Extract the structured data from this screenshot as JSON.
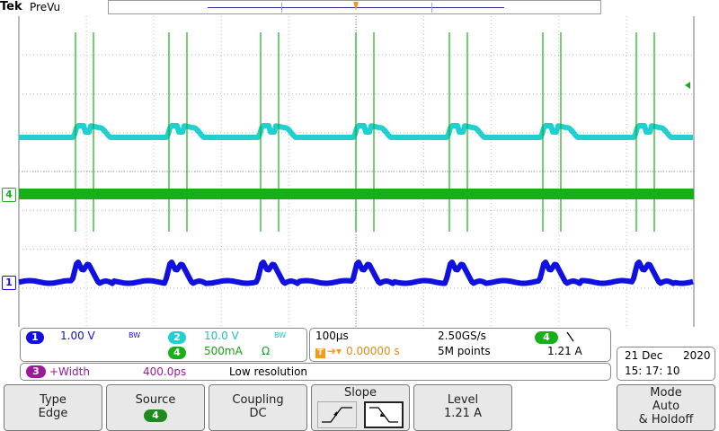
{
  "header": {
    "brand": "Tek",
    "mode": "PreVu"
  },
  "markers": {
    "trigger": "T",
    "ch4_ref": "4",
    "ch1_ref": "1"
  },
  "channels": {
    "ch1": {
      "num": "1",
      "scale": "1.00 V",
      "bw": "BW",
      "color": "#1010e0"
    },
    "ch2": {
      "num": "2",
      "scale": "10.0 V",
      "bw": "BW",
      "color": "#20d0d0"
    },
    "ch4": {
      "num": "4",
      "scale": "500mA",
      "coupling": "Ω",
      "color": "#18b018"
    }
  },
  "acquisition": {
    "timebase": "100µs",
    "sample_rate": "2.50GS/s",
    "trigger_position": "0.00000 s",
    "record_length": "5M points",
    "trigger_source": "4",
    "trigger_slope_icon": "falling-slope",
    "trigger_level": "1.21 A"
  },
  "measurement": {
    "num": "3",
    "label": "+Width",
    "value": "400.0ps",
    "status": "Low resolution"
  },
  "datetime": {
    "date": "21 Dec",
    "year": "2020",
    "time": "15: 17: 10"
  },
  "menu": {
    "type": {
      "label": "Type",
      "value": "Edge"
    },
    "source": {
      "label": "Source",
      "value": "4"
    },
    "coupling": {
      "label": "Coupling",
      "value": "DC"
    },
    "slope": {
      "label": "Slope"
    },
    "level": {
      "label": "Level",
      "value": "1.21 A"
    },
    "mode": {
      "label": "Mode",
      "value1": "Auto",
      "value2": "& Holdoff"
    }
  }
}
